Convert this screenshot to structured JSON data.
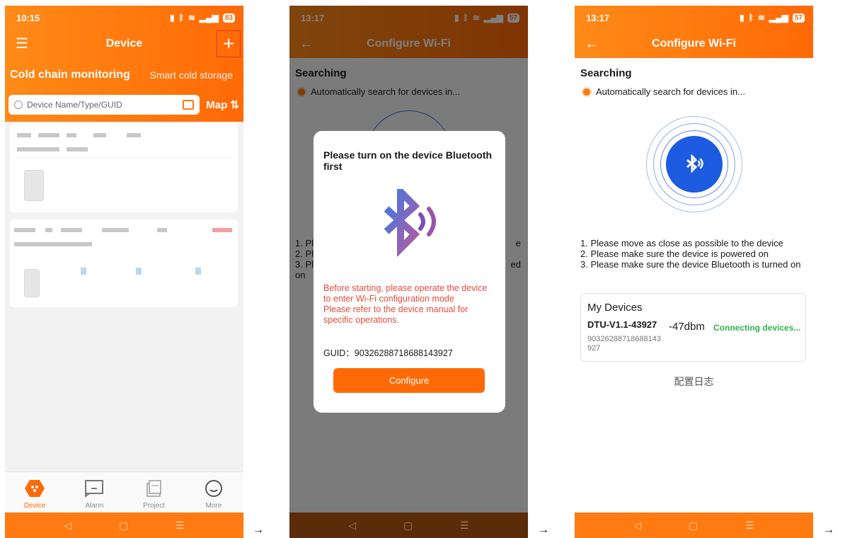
{
  "screen1": {
    "status_time": "10:15",
    "battery": "83",
    "title": "Device",
    "add_icon": "plus-icon",
    "menu_icon": "hamburger-icon",
    "tabs": [
      "Cold chain monitoring",
      "Smart cold storage"
    ],
    "search_placeholder": "Device Name/Type/GUID",
    "map_label": "Map",
    "bottom_tabs": [
      {
        "label": "Device",
        "icon": "device-icon"
      },
      {
        "label": "Alarm",
        "icon": "alarm-icon"
      },
      {
        "label": "Project",
        "icon": "project-icon"
      },
      {
        "label": "More",
        "icon": "more-icon"
      }
    ],
    "accent": "#ff6a06"
  },
  "screen2": {
    "status_time": "13:17",
    "battery": "57",
    "title": "Configure Wi-Fi",
    "searching": "Searching",
    "auto_search": "Automatically search for devices in...",
    "tips_partial": [
      "1. Pl",
      "2. Pl",
      "3. Pl",
      "on"
    ],
    "tips_right": [
      "e",
      "",
      "ed",
      ""
    ],
    "dialog": {
      "title": "Please turn on the device Bluetooth first",
      "warning": "Before starting, please operate the device to enter Wi-Fi configuration mode\nPlease refer to the device manual for specific operations.",
      "guid": "GUID：90326288718688143927",
      "button": "Configure"
    }
  },
  "screen3": {
    "status_time": "13:17",
    "battery": "57",
    "title": "Configure Wi-Fi",
    "searching": "Searching",
    "auto_search": "Automatically search for devices in...",
    "tips": [
      "1. Please move as close as possible to the device",
      "2. Please make sure the device is powered on",
      "3. Please make sure the device Bluetooth is turned on"
    ],
    "my_devices": "My Devices",
    "device_name": "DTU-V1.1-43927",
    "device_guid": "90326288718688143927",
    "signal": "-47dbm",
    "connecting": "Connecting devices...",
    "config_log": "配置日志"
  },
  "arrow": "→"
}
